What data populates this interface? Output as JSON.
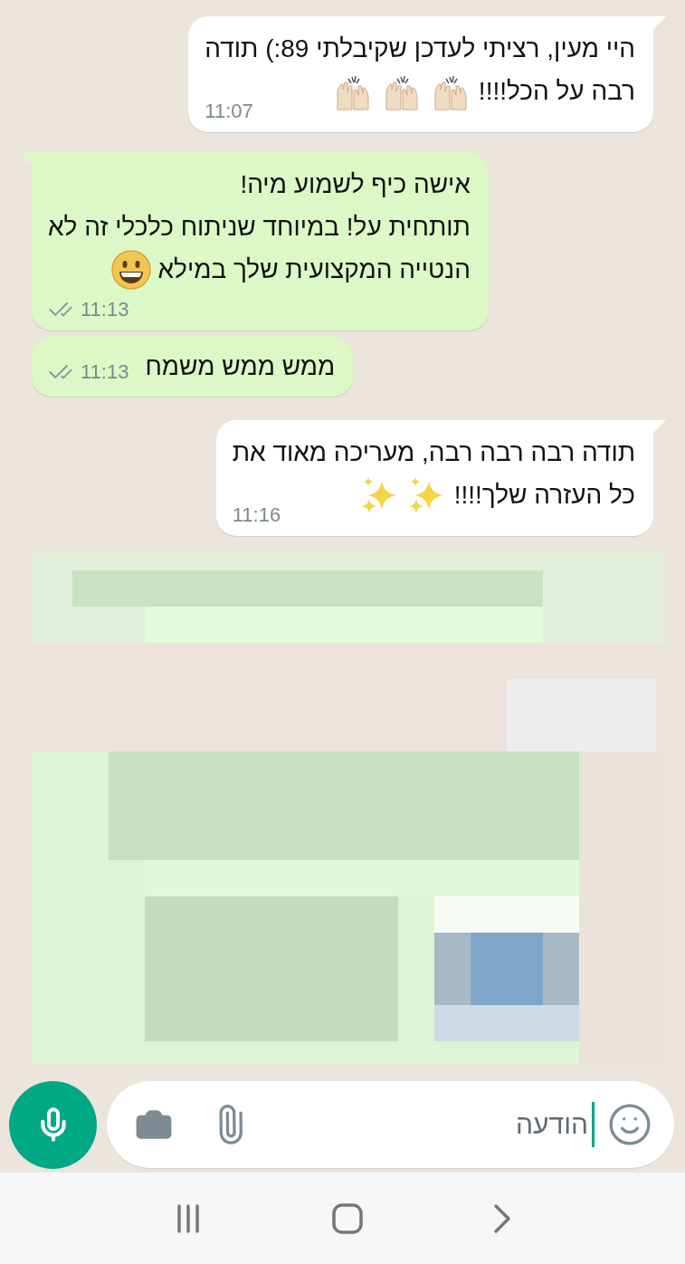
{
  "messages": [
    {
      "kind": "incoming",
      "tail": true,
      "lines": [
        {
          "text": "היי מעין, רציתי לעדכן שקיבלתי 89:) תודה"
        },
        {
          "text": "רבה על הכל!!!!",
          "icons": [
            {
              "kind": "raised-hands"
            },
            {
              "kind": "raised-hands"
            },
            {
              "kind": "raised-hands"
            }
          ]
        }
      ],
      "time": "11:07"
    },
    {
      "kind": "outgoing",
      "tail": true,
      "lines": [
        {
          "text": "אישה כיף לשמוע מיה!"
        },
        {
          "text": "תותחית על! במיוחד שניתוח כלכלי זה לא"
        },
        {
          "text": "הנטייה המקצועית שלך במילא",
          "icons": [
            {
              "kind": "grin"
            }
          ]
        }
      ],
      "time": "11:13",
      "read": false
    },
    {
      "kind": "outgoing",
      "tail": false,
      "lines": [
        {
          "text": "ממש ממש משמח"
        }
      ],
      "time": "11:13",
      "read": false
    },
    {
      "kind": "incoming",
      "tail": true,
      "lines": [
        {
          "text": "תודה רבה רבה רבה, מעריכה מאוד את"
        },
        {
          "text": "כל העזרה שלך!!!!",
          "icons": [
            {
              "kind": "sparkles"
            },
            {
              "kind": "sparkles"
            }
          ]
        }
      ],
      "time": "11:16"
    },
    {
      "kind": "picture"
    }
  ],
  "composer": {
    "placeholder": "הודעה"
  }
}
